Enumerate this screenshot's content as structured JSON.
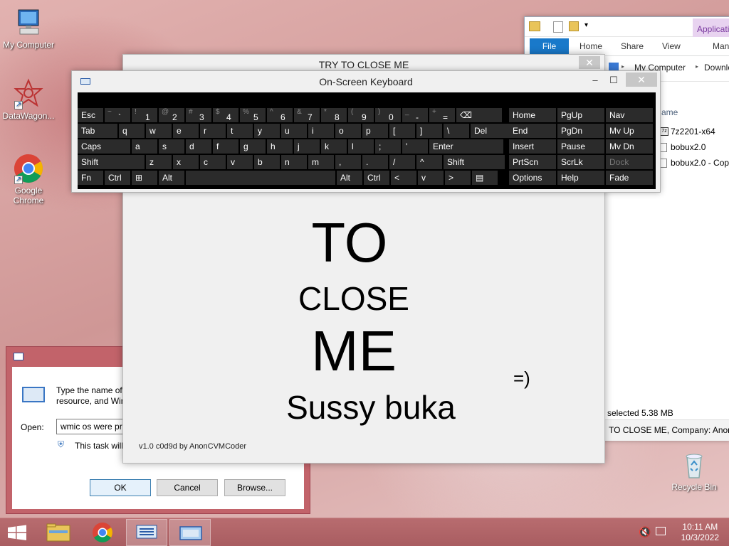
{
  "desktop": {
    "icons": [
      {
        "label": "My Computer"
      },
      {
        "label": "DataWagon..."
      },
      {
        "label": "Google Chrome"
      },
      {
        "label": "Recycle Bin"
      }
    ]
  },
  "explorer": {
    "file_tab": "File",
    "tabs": [
      "Home",
      "Share",
      "View",
      "Mana"
    ],
    "app_tab": "Applicatio",
    "breadcrumb": [
      "My Computer",
      "Downlo"
    ],
    "column_header": "ame",
    "files": [
      "7z2201-x64",
      "bobux2.0",
      "bobux2.0 - Copy"
    ],
    "status": "selected  5.38 MB",
    "details": "TO CLOSE ME, Company: AnonC"
  },
  "main_window": {
    "title": "TRY TO CLOSE ME",
    "close_glyph": "✕",
    "big_to": "TO",
    "big_close": "CLOSE",
    "big_me": "ME",
    "smiley": "=)",
    "tagline": "Sussy buka",
    "version": "v1.0 c0d9d by AnonCVMCoder"
  },
  "run_dialog": {
    "description_line1": "Type the name of",
    "description_line2": "resource, and Wir",
    "open_label": "Open:",
    "open_value": "wmic os were pr",
    "task_note": "This task will",
    "ok_label": "OK",
    "cancel_label": "Cancel",
    "browse_label": "Browse..."
  },
  "osk": {
    "title": "On-Screen Keyboard",
    "minimize_glyph": "‒",
    "maximize_glyph": "☐",
    "close_glyph": "✕",
    "row1": [
      {
        "label": "Esc"
      },
      {
        "alt": "~",
        "main": "`"
      },
      {
        "alt": "!",
        "main": "1"
      },
      {
        "alt": "@",
        "main": "2"
      },
      {
        "alt": "#",
        "main": "3"
      },
      {
        "alt": "$",
        "main": "4"
      },
      {
        "alt": "%",
        "main": "5"
      },
      {
        "alt": "^",
        "main": "6"
      },
      {
        "alt": "&",
        "main": "7"
      },
      {
        "alt": "*",
        "main": "8"
      },
      {
        "alt": "(",
        "main": "9"
      },
      {
        "alt": ")",
        "main": "0"
      },
      {
        "alt": "_",
        "main": "-"
      },
      {
        "alt": "+",
        "main": "="
      },
      {
        "label": "⌫"
      }
    ],
    "row2": [
      "Tab",
      "q",
      "w",
      "e",
      "r",
      "t",
      "y",
      "u",
      "i",
      "o",
      "p",
      "[",
      "]",
      "\\",
      "Del"
    ],
    "row3": [
      "Caps",
      "a",
      "s",
      "d",
      "f",
      "g",
      "h",
      "j",
      "k",
      "l",
      ";",
      "'",
      "Enter"
    ],
    "row4": [
      "Shift",
      "z",
      "x",
      "c",
      "v",
      "b",
      "n",
      "m",
      ",",
      ".",
      "/",
      "^",
      "Shift"
    ],
    "row5": [
      "Fn",
      "Ctrl",
      "⊞",
      "Alt",
      "",
      "Alt",
      "Ctrl",
      "<",
      "v",
      ">",
      "▤"
    ],
    "nav": [
      [
        "Home",
        "PgUp",
        "Nav"
      ],
      [
        "End",
        "PgDn",
        "Mv Up"
      ],
      [
        "Insert",
        "Pause",
        "Mv Dn"
      ],
      [
        "PrtScn",
        "ScrLk",
        "Dock"
      ],
      [
        "Options",
        "Help",
        "Fade"
      ]
    ]
  },
  "taskbar": {
    "time": "10:11 AM",
    "date": "10/3/2022"
  }
}
